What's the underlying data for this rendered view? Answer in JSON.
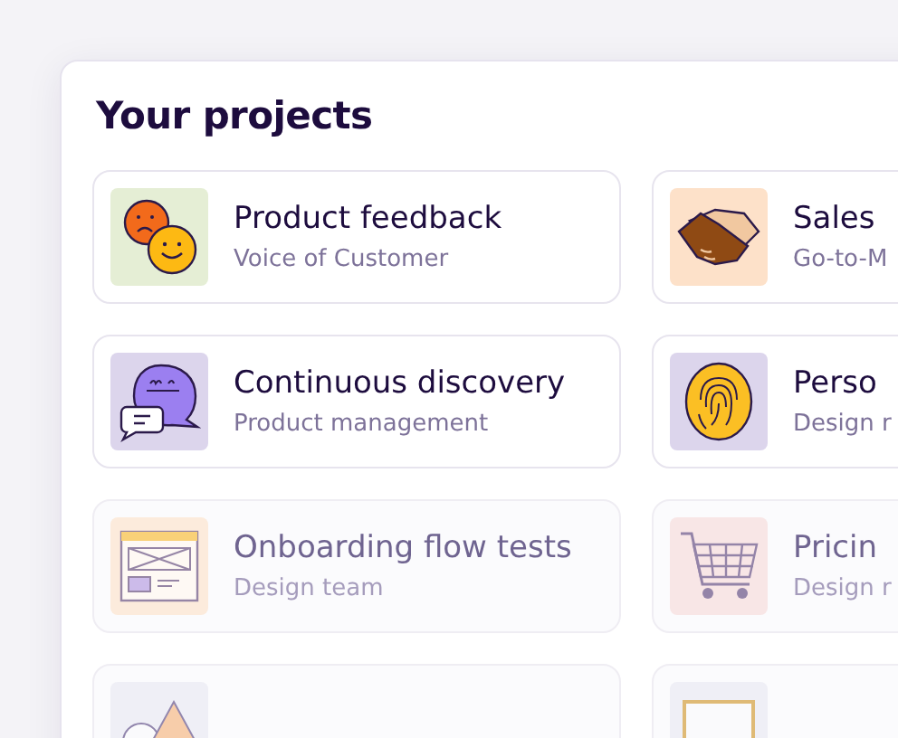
{
  "heading": "Your projects",
  "projects": [
    {
      "title": "Product feedback",
      "team": "Voice of Customer",
      "kind": "faces",
      "color": "#e5eed5",
      "dimmed": false
    },
    {
      "title": "Sales",
      "team": "Go-to-M",
      "kind": "handshake",
      "color": "#fde1c9",
      "dimmed": false
    },
    {
      "title": "Continuous discovery",
      "team": "Product management",
      "kind": "chat",
      "color": "#dcd5ec",
      "dimmed": false
    },
    {
      "title": "Perso",
      "team": "Design r",
      "kind": "fingerprint",
      "color": "#dcd5ec",
      "dimmed": false
    },
    {
      "title": "Onboarding flow tests",
      "team": "Design team",
      "kind": "wireframe",
      "color": "#fcebdc",
      "dimmed": true
    },
    {
      "title": "Pricin",
      "team": "Design r",
      "kind": "cart",
      "color": "#f8e6e6",
      "dimmed": true
    },
    {
      "kind": "shapes",
      "color": "#efeff6",
      "dimmed": true
    },
    {
      "kind": "frame",
      "color": "#efeff6",
      "dimmed": true
    }
  ]
}
